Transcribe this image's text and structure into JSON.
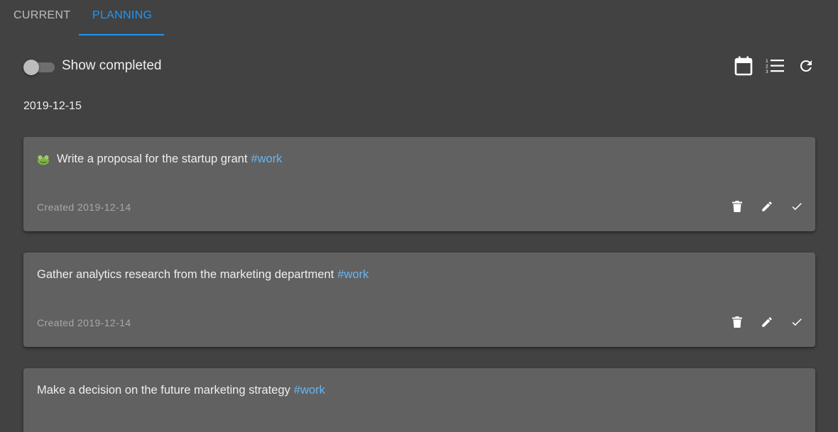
{
  "tabs": [
    {
      "label": "CURRENT",
      "active": false
    },
    {
      "label": "PLANNING",
      "active": true
    }
  ],
  "toolbar": {
    "show_completed_label": "Show completed",
    "show_completed_on": false,
    "icons": [
      "calendar-icon",
      "list-numbered-icon",
      "refresh-icon"
    ]
  },
  "date_heading": "2019-12-15",
  "tasks": [
    {
      "title": "Write a proposal for the startup grant",
      "tag": "#work",
      "created": "Created 2019-12-14",
      "icon": "frog-icon"
    },
    {
      "title": "Gather analytics research from the marketing department",
      "tag": "#work",
      "created": "Created 2019-12-14"
    },
    {
      "title": "Make a decision on the future marketing strategy",
      "tag": "#work",
      "created": ""
    }
  ],
  "colors": {
    "background": "#424242",
    "card": "#616161",
    "accent": "#2196f3",
    "tag": "#64b5f6"
  }
}
